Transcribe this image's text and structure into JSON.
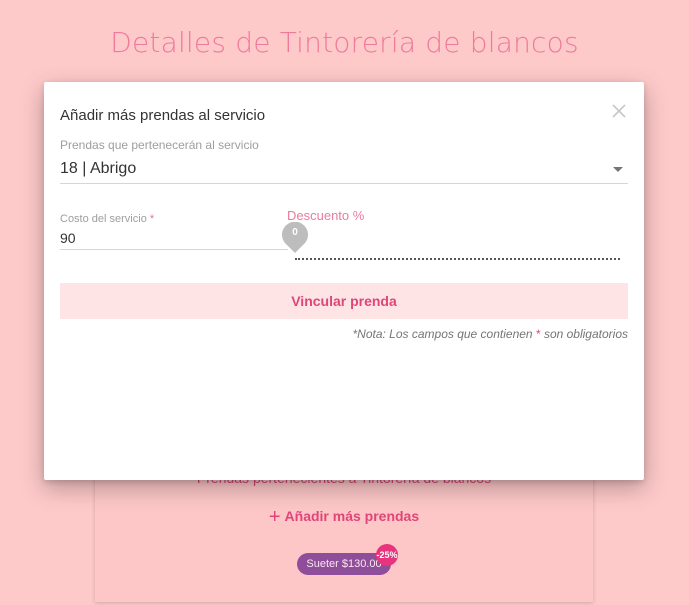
{
  "page": {
    "title": "Detalles de Tintorería de blancos"
  },
  "background_card": {
    "section_title": "Prendas pertenecientes a Tintorería de blancos",
    "add_more_label": "Añadir más prendas",
    "chip_label": "Sueter $130.00",
    "chip_badge": "-25%"
  },
  "dialog": {
    "title": "Añadir más prendas al servicio",
    "close_icon": "close-icon",
    "select": {
      "label": "Prendas que pertenecerán al servicio",
      "value": "18 | Abrigo"
    },
    "cost": {
      "label": "Costo del servicio",
      "required_mark": "*",
      "value": "90"
    },
    "discount": {
      "label": "Descuento %",
      "value": "0"
    },
    "link_button_label": "Vincular prenda",
    "note_prefix": "*Nota: Los campos que contienen ",
    "note_mark": "*",
    "note_suffix": " son obligatorios"
  },
  "colors": {
    "background": "#fec9c9",
    "accent": "#e0457a",
    "title_pink": "#ee7a9c",
    "chip_purple": "#8e4e9a"
  }
}
